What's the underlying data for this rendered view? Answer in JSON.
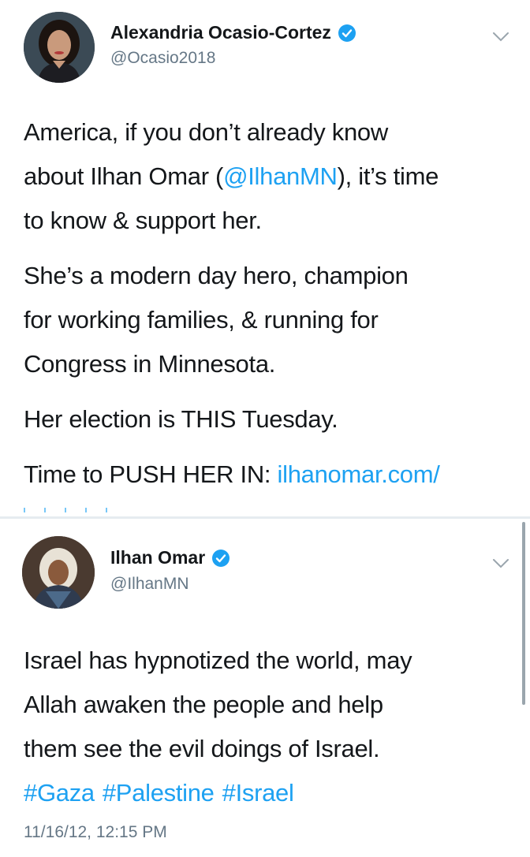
{
  "tweets": [
    {
      "name": "Alexandria Ocasio-Cortez",
      "handle": "@Ocasio2018",
      "avatar_icon": "profile-photo-woman-dark-hair",
      "verified_icon": "verified-badge-icon",
      "paragraphs": [
        {
          "lines": [
            "America, if you don’t already know",
            "about Ilhan Omar (",
            "), it’s time",
            "to know & support her."
          ],
          "mention": "@IlhanMN"
        },
        {
          "lines": [
            "She’s a modern day hero, champion",
            "for working families, & running for",
            "Congress in Minnesota."
          ]
        },
        {
          "lines": [
            "Her election is THIS Tuesday."
          ]
        },
        {
          "lines": [
            "Time to PUSH HER IN: "
          ],
          "link": "ilhanomar.com/"
        }
      ]
    },
    {
      "name": "Ilhan Omar",
      "handle": "@IlhanMN",
      "avatar_icon": "profile-photo-woman-headscarf",
      "verified_icon": "verified-badge-icon",
      "lines": [
        "Israel has hypnotized the world, may",
        "Allah awaken the people and help",
        "them see the evil doings of Israel."
      ],
      "hashtags": [
        "#Gaza",
        "#Palestine",
        "#Israel"
      ],
      "timestamp": "11/16/12, 12:15 PM"
    }
  ],
  "colors": {
    "link": "#1da1f2",
    "text": "#14171a",
    "secondary": "#657786"
  }
}
